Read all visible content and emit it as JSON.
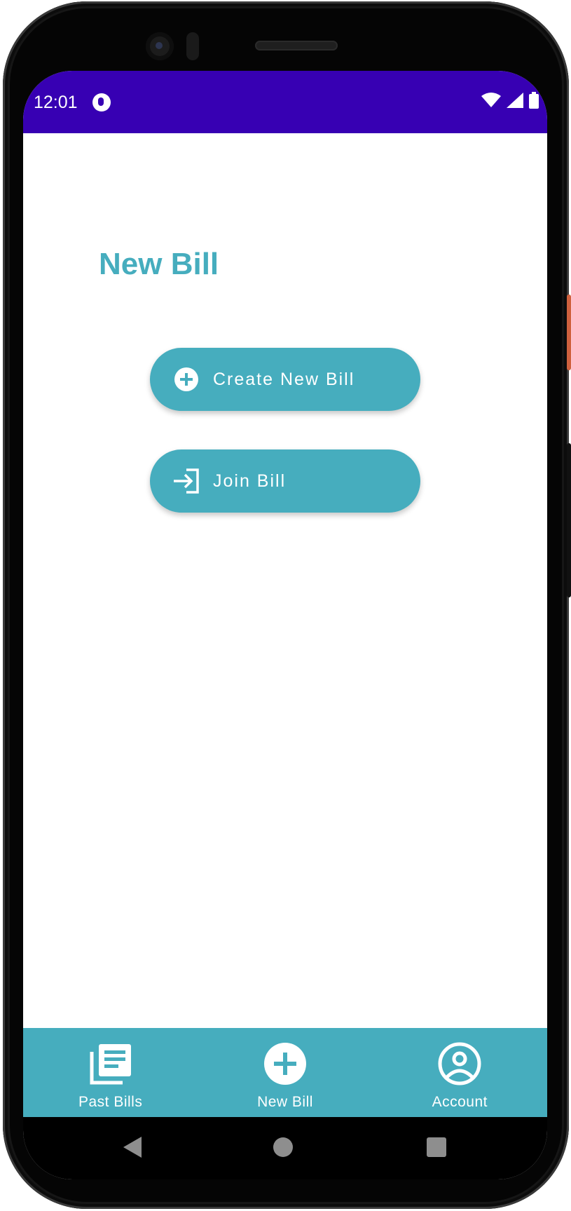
{
  "status_bar": {
    "time": "12:01",
    "background": "#3700b3",
    "icons": [
      "notification-icon",
      "wifi-icon",
      "cell-signal-icon",
      "battery-icon"
    ]
  },
  "page": {
    "title": "New Bill",
    "accent": "#46adbe"
  },
  "actions": {
    "create": {
      "label": "Create New Bill",
      "icon": "add-circle-icon"
    },
    "join": {
      "label": "Join Bill",
      "icon": "login-icon"
    }
  },
  "bottom_nav": {
    "items": [
      {
        "label": "Past Bills",
        "icon": "library-books-icon"
      },
      {
        "label": "New Bill",
        "icon": "add-circle-icon"
      },
      {
        "label": "Account",
        "icon": "account-circle-icon"
      }
    ]
  },
  "system_nav": {
    "icons": [
      "back-icon",
      "home-icon",
      "recents-icon"
    ]
  }
}
